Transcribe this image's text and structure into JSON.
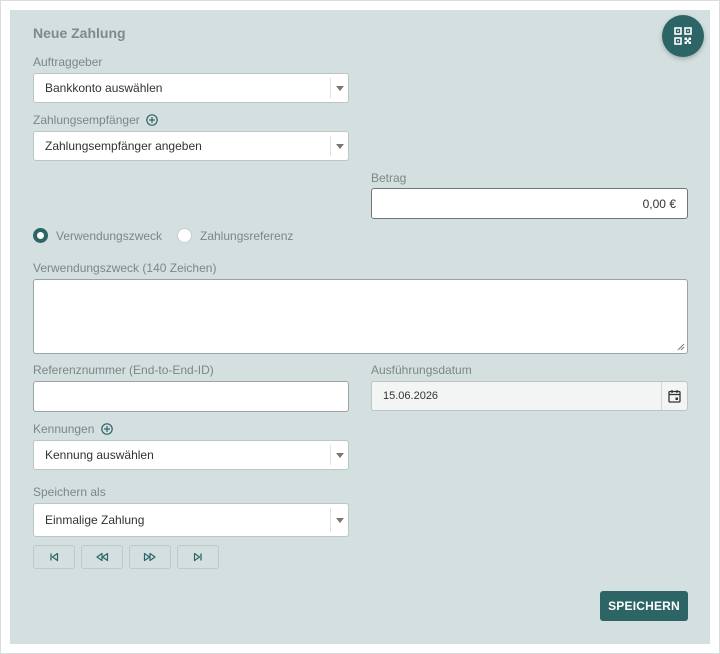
{
  "form": {
    "title": "Neue Zahlung",
    "auftraggeber": {
      "label": "Auftraggeber",
      "value": "Bankkonto auswählen"
    },
    "empfaenger": {
      "label": "Zahlungsempfänger",
      "value": "Zahlungsempfänger angeben"
    },
    "betrag": {
      "label": "Betrag",
      "value": "0,00 €"
    },
    "purpose_options": {
      "option1": {
        "label": "Verwendungszweck",
        "selected": true
      },
      "option2": {
        "label": "Zahlungsreferenz",
        "selected": false
      }
    },
    "verwendungszweck": {
      "label": "Verwendungszweck (140 Zeichen)",
      "value": ""
    },
    "referenz": {
      "label": "Referenznummer (End-to-End-ID)",
      "value": ""
    },
    "datum": {
      "label": "Ausführungsdatum",
      "value": "15.06.2026"
    },
    "kennungen": {
      "label": "Kennungen",
      "value": "Kennung auswählen"
    },
    "speichern_als": {
      "label": "Speichern als",
      "value": "Einmalige Zahlung"
    },
    "save_label": "SPEICHERN"
  },
  "icons": {
    "qr": "qr-code-icon",
    "first": "skip-first-icon",
    "rewind": "rewind-icon",
    "forward": "fast-forward-icon",
    "last": "skip-last-icon",
    "calendar": "calendar-icon",
    "add": "plus-circle-icon"
  },
  "colors": {
    "accent": "#2d6466",
    "panel": "#d4e0e0"
  }
}
